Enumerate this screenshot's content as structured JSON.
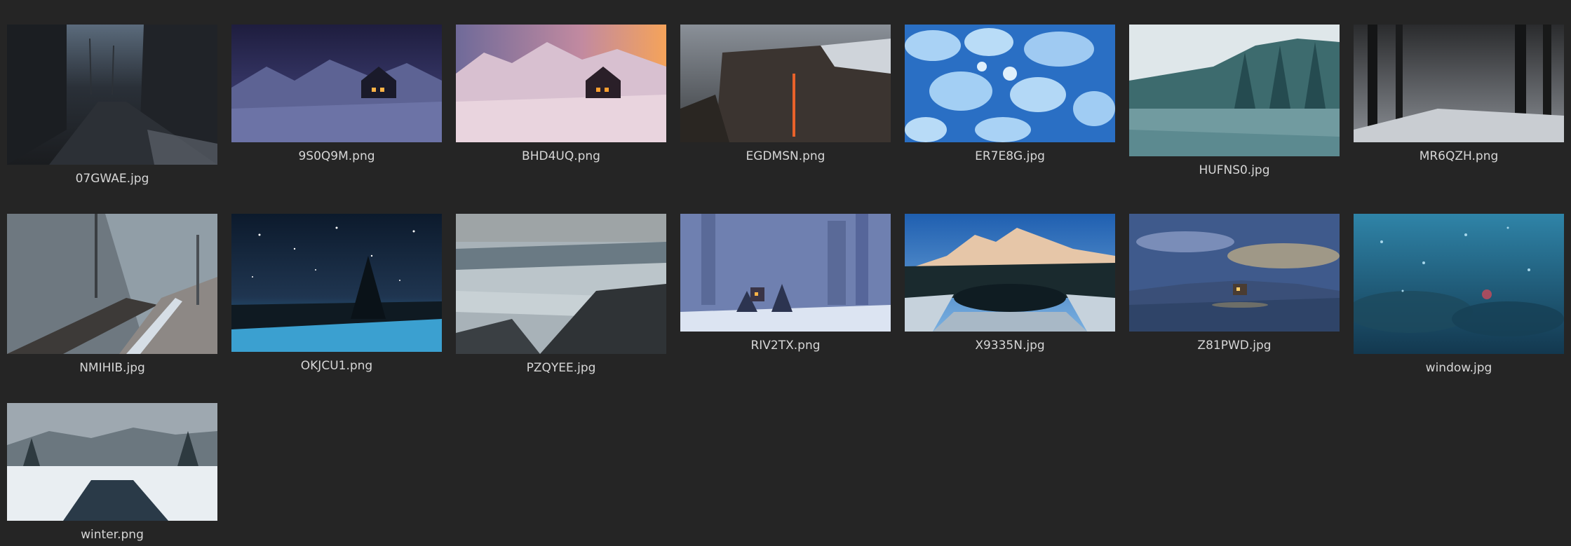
{
  "files": [
    {
      "name": "07GWAE.jpg",
      "thumbnail": "dark-alley-snow"
    },
    {
      "name": "9S0Q9M.png",
      "thumbnail": "night-cabin-mountains"
    },
    {
      "name": "BHD4UQ.png",
      "thumbnail": "sunset-cabin-mountains"
    },
    {
      "name": "EGDMSN.png",
      "thumbnail": "firefall-cliff"
    },
    {
      "name": "ER7E8G.jpg",
      "thumbnail": "frozen-ice-bubbles"
    },
    {
      "name": "HUFNS0.jpg",
      "thumbnail": "snowy-forest-lake"
    },
    {
      "name": "MR6QZH.png",
      "thumbnail": "dark-snowy-forest"
    },
    {
      "name": "NMIHIB.jpg",
      "thumbnail": "foggy-railway"
    },
    {
      "name": "OKJCU1.png",
      "thumbnail": "starry-night-forest"
    },
    {
      "name": "PZQYEE.jpg",
      "thumbnail": "stormy-sea-rocks"
    },
    {
      "name": "RIV2TX.png",
      "thumbnail": "fantasy-snow-towers"
    },
    {
      "name": "X9335N.jpg",
      "thumbnail": "alpine-lake-peaks"
    },
    {
      "name": "Z81PWD.jpg",
      "thumbnail": "lakeside-cabin-dusk"
    },
    {
      "name": "window.jpg",
      "thumbnail": "rainy-window"
    },
    {
      "name": "winter.png",
      "thumbnail": "winter-river-valley"
    }
  ]
}
